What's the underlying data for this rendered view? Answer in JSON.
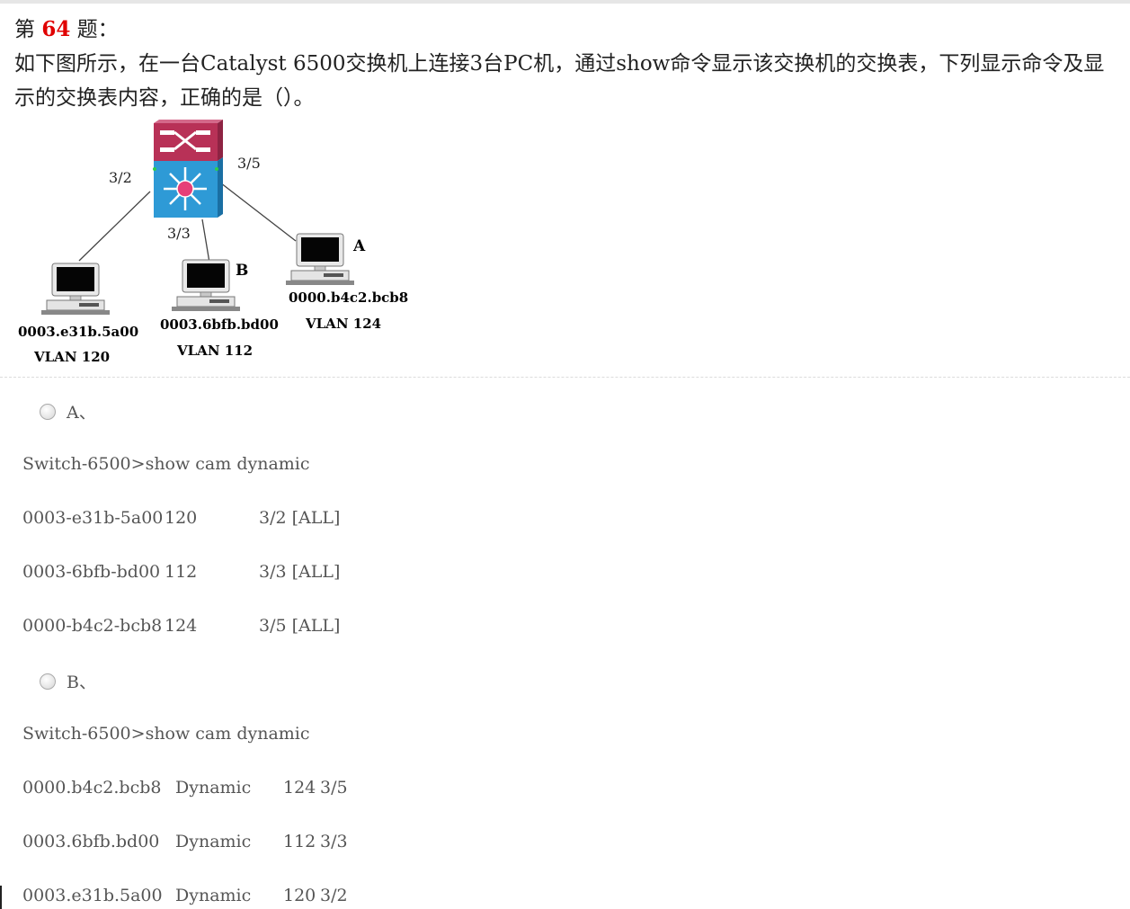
{
  "question": {
    "prefix": "第",
    "number": "64",
    "suffix": "题：",
    "text": "如下图所示，在一台Catalyst 6500交换机上连接3台PC机，通过show命令显示该交换机的交换表，下列显示命令及显示的交换表内容，正确的是（）。"
  },
  "diagram": {
    "ports": {
      "p1": "3/2",
      "p2": "3/3",
      "p3": "3/5"
    },
    "hosts": [
      {
        "mac": "0003.e31b.5a00",
        "vlan": "VLAN 120",
        "tag": ""
      },
      {
        "mac": "0003.6bfb.bd00",
        "vlan": "VLAN 112",
        "tag": "B"
      },
      {
        "mac": "0000.b4c2.bcb8",
        "vlan": "VLAN 124",
        "tag": "A"
      }
    ]
  },
  "options": [
    {
      "label": "A、",
      "command": "Switch-6500>show cam dynamic",
      "rows": [
        [
          "0003-e31b-5a00",
          "120",
          "3/2 [ALL]"
        ],
        [
          "0003-6bfb-bd00",
          "112",
          "3/3 [ALL]"
        ],
        [
          "0000-b4c2-bcb8",
          "124",
          "3/5 [ALL]"
        ]
      ]
    },
    {
      "label": "B、",
      "command": "Switch-6500>show cam dynamic",
      "rows": [
        [
          "0000.b4c2.bcb8",
          "Dynamic",
          "124",
          "3/5"
        ],
        [
          "0003.6bfb.bd00",
          "Dynamic",
          "112",
          "3/3"
        ],
        [
          "0003.e31b.5a00",
          "Dynamic",
          "120",
          "3/2"
        ]
      ]
    }
  ]
}
